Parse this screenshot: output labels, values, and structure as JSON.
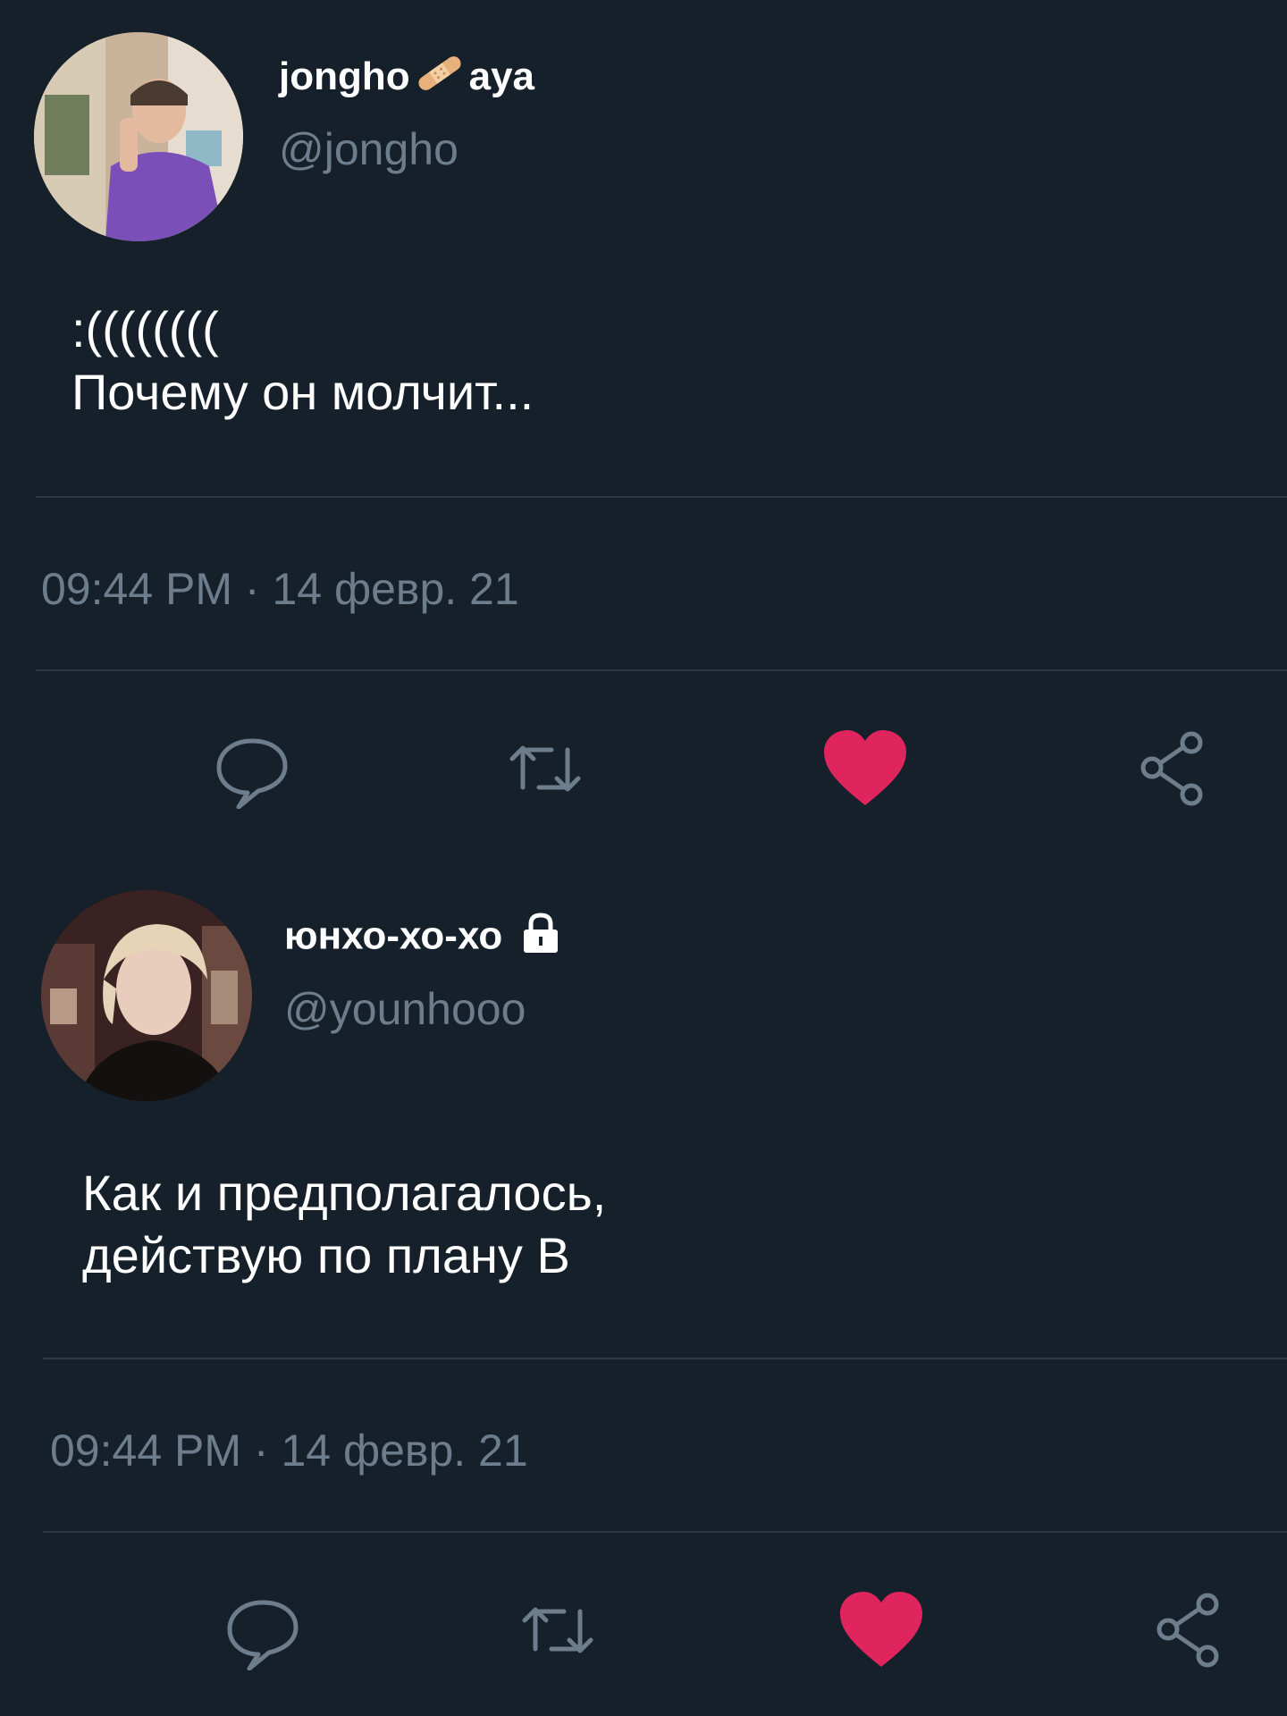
{
  "colors": {
    "background": "#15202b",
    "text_primary": "#ffffff",
    "text_secondary": "#6e7d8c",
    "divider": "#2b3947",
    "icon": "#6e7d8c",
    "like_active": "#e0245e"
  },
  "tweets": [
    {
      "author": {
        "name_part1": "jongho",
        "name_emoji": "adhesive-bandage-emoji",
        "name_part2": "aya",
        "handle": "@jongho",
        "avatar": "avatar-photo"
      },
      "text_lines": [
        ":((((((((",
        "Почему он молчит..."
      ],
      "timestamp": "09:44 PM · 14 февр. 21",
      "actions": {
        "reply": "reply-icon",
        "retweet": "retweet-icon",
        "like": "heart-icon",
        "share": "share-icon"
      },
      "liked": true
    },
    {
      "author": {
        "name": "юнхо-хо-хо",
        "locked_icon": "lock-icon",
        "handle": "@younhooo",
        "avatar": "avatar-photo"
      },
      "text_lines": [
        "Как и предполагалось,",
        "действую по плану В"
      ],
      "timestamp": "09:44 PM · 14 февр. 21",
      "actions": {
        "reply": "reply-icon",
        "retweet": "retweet-icon",
        "like": "heart-icon",
        "share": "share-icon"
      },
      "liked": true
    }
  ]
}
